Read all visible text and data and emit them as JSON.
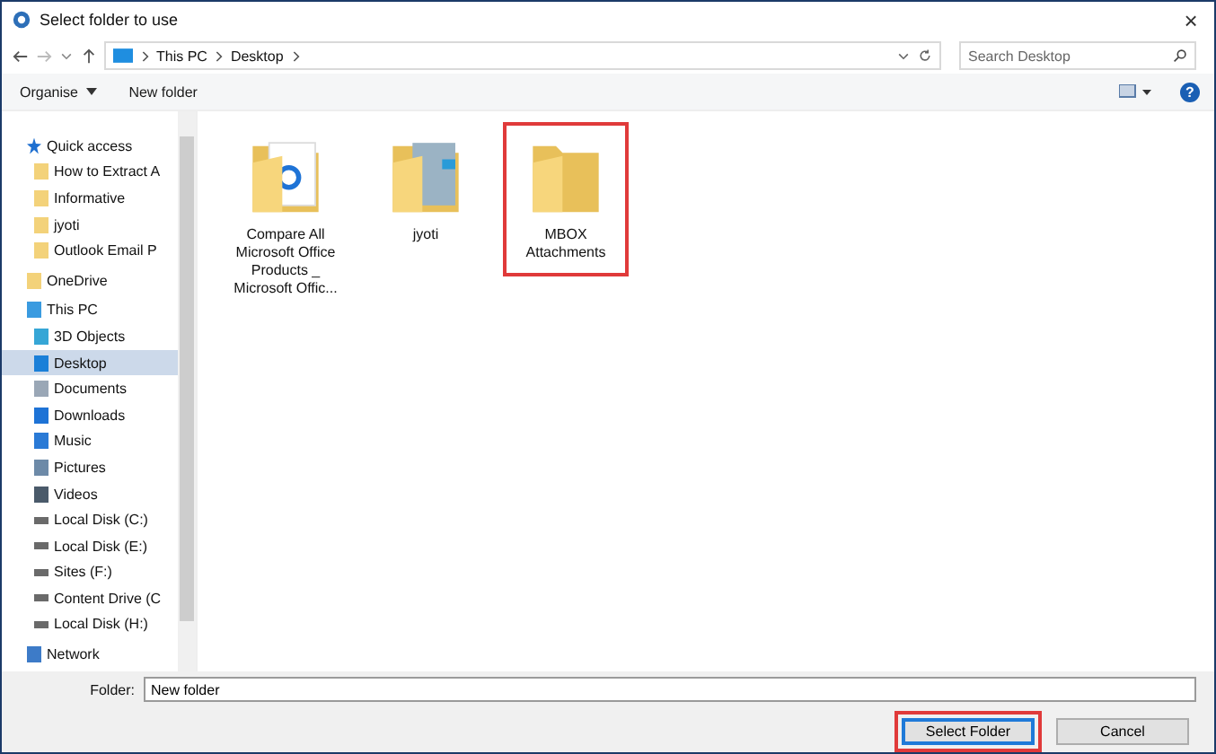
{
  "window": {
    "title": "Select folder to use",
    "close": "×"
  },
  "address": {
    "path": [
      "This PC",
      "Desktop"
    ],
    "search_placeholder": "Search Desktop"
  },
  "toolbar": {
    "organise": "Organise",
    "new_folder": "New folder",
    "help": "?"
  },
  "sidebar": [
    {
      "label": "Quick access",
      "kind": "star",
      "selected": false,
      "children": [
        {
          "label": "How to Extract A",
          "kind": "folder",
          "selected": false
        },
        {
          "label": "Informative",
          "kind": "folder",
          "selected": false
        },
        {
          "label": "jyoti",
          "kind": "folder",
          "selected": false
        },
        {
          "label": "Outlook Email P",
          "kind": "folder",
          "selected": false
        }
      ]
    },
    {
      "label": "OneDrive",
      "kind": "folder",
      "selected": false
    },
    {
      "label": "This PC",
      "kind": "pc",
      "selected": false,
      "children": [
        {
          "label": "3D Objects",
          "kind": "cube",
          "selected": false
        },
        {
          "label": "Desktop",
          "kind": "desktop",
          "selected": true
        },
        {
          "label": "Documents",
          "kind": "document",
          "selected": false
        },
        {
          "label": "Downloads",
          "kind": "download",
          "selected": false
        },
        {
          "label": "Music",
          "kind": "music",
          "selected": false
        },
        {
          "label": "Pictures",
          "kind": "pictures",
          "selected": false
        },
        {
          "label": "Videos",
          "kind": "videos",
          "selected": false
        },
        {
          "label": "Local Disk (C:)",
          "kind": "disk",
          "selected": false
        },
        {
          "label": "Local Disk (E:)",
          "kind": "disk",
          "selected": false
        },
        {
          "label": "Sites (F:)",
          "kind": "disk",
          "selected": false
        },
        {
          "label": "Content Drive (C",
          "kind": "disk",
          "selected": false
        },
        {
          "label": "Local Disk (H:)",
          "kind": "disk",
          "selected": false
        }
      ]
    },
    {
      "label": "Network",
      "kind": "network",
      "selected": false
    }
  ],
  "files": [
    {
      "name": "Compare All Microsoft Office Products _ Microsoft Offic...",
      "kind": "doc-folder",
      "highlighted": false
    },
    {
      "name": "jyoti",
      "kind": "photo-folder",
      "highlighted": false
    },
    {
      "name": "MBOX Attachments",
      "kind": "folder",
      "highlighted": true
    }
  ],
  "footer": {
    "folder_label": "Folder:",
    "folder_value": "New folder",
    "buttons": [
      {
        "label": "Select Folder",
        "highlighted": true,
        "default": true
      },
      {
        "label": "Cancel",
        "highlighted": false,
        "default": false
      }
    ]
  }
}
